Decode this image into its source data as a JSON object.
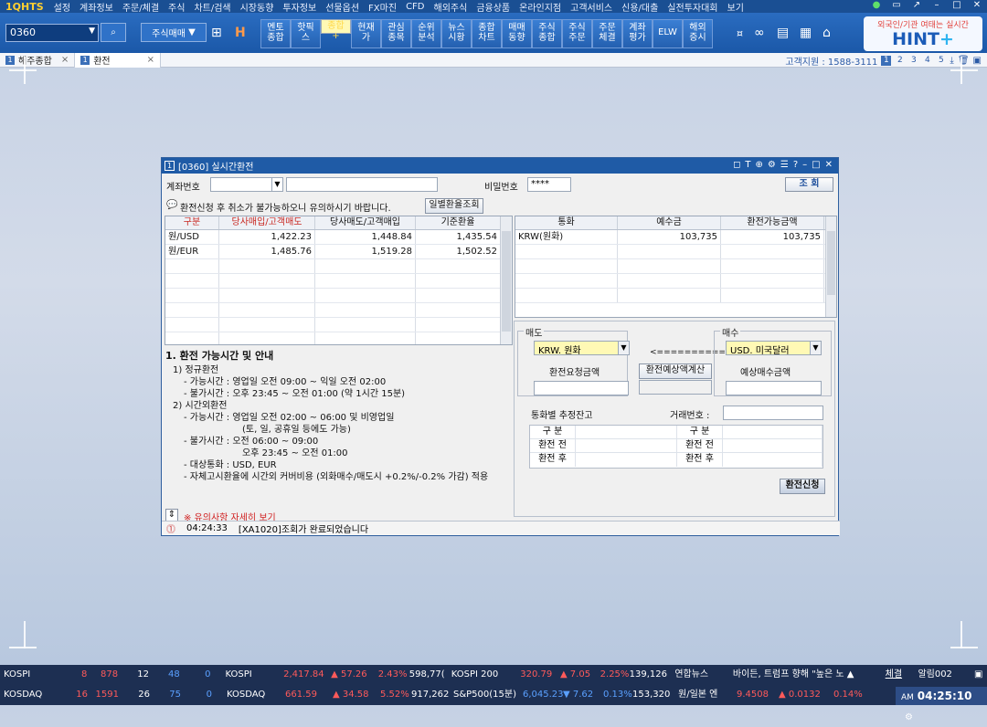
{
  "app": {
    "logo": "1QHTS"
  },
  "menu": [
    "설정",
    "계좌정보",
    "주문/체결",
    "주식",
    "차트/검색",
    "시장동향",
    "투자정보",
    "선물옵션",
    "FX마진",
    "CFD",
    "해외주식",
    "금융상품",
    "온라인지점",
    "고객서비스",
    "신용/대출",
    "실전투자대회",
    "보기"
  ],
  "toolbar": {
    "code_value": "0360",
    "stock_order": "주식매매",
    "quick_buttons": [
      {
        "label": "멘토\n종합"
      },
      {
        "label": "핫픽\n스"
      },
      {
        "label": "종합\n+"
      },
      {
        "label": "현재\n가"
      },
      {
        "label": "관심\n종목"
      },
      {
        "label": "순위\n분석"
      },
      {
        "label": "뉴스\n시황"
      },
      {
        "label": "종합\n차트"
      },
      {
        "label": "매매\n동향"
      },
      {
        "label": "주식\n종합"
      },
      {
        "label": "주식\n주문"
      },
      {
        "label": "주문\n체결"
      },
      {
        "label": "계좌\n평가"
      },
      {
        "label": "ELW"
      },
      {
        "label": "해외\n증시"
      }
    ],
    "hint_small": "외국인/기관 여태는 실시간",
    "hint_big": "HINT",
    "hint_plus": "+"
  },
  "tabs": [
    {
      "label": "해주종합"
    },
    {
      "label": "환전"
    }
  ],
  "tabbar_right": {
    "support": "고객지원 : 1588-3111",
    "pages": [
      "1",
      "2",
      "3",
      "4",
      "5"
    ]
  },
  "window": {
    "title": "[0360] 실시간환전",
    "account_label": "계좌번호",
    "password_label": "비밀번호",
    "password_value": "****",
    "query_button": "조 회",
    "notice": "환전신청 후 취소가 불가능하오니 유의하시기 바랍니다.",
    "daily_rate_button": "일별환율조회",
    "rate_table": {
      "headers": [
        "구분",
        "당사매입/고객매도",
        "당사매도/고객매입",
        "기준환율"
      ],
      "rows": [
        [
          "원/USD",
          "1,422.23",
          "1,448.84",
          "1,435.54"
        ],
        [
          "원/EUR",
          "1,485.76",
          "1,519.28",
          "1,502.52"
        ]
      ]
    },
    "balance_table": {
      "headers": [
        "통화",
        "예수금",
        "환전가능금액"
      ],
      "rows": [
        [
          "KRW(원화)",
          "103,735",
          "103,735"
        ]
      ]
    },
    "guide": {
      "heading": "1. 환전 가능시간 및 안내",
      "lines": [
        "1) 정규환전",
        "- 가능시간 : 영업일 오전 09:00 ~ 익일 오전 02:00",
        "- 불가시간 : 오후 23:45 ~ 오전 01:00 (약 1시간 15분)",
        "2) 시간외환전",
        "- 가능시간 : 영업일 오전 02:00 ~ 06:00 및 비영업일",
        "(토, 일, 공휴일 등에도 가능)",
        "- 불가시간 : 오전 06:00 ~ 09:00",
        "오후 23:45 ~ 오전 01:00",
        "- 대상통화 : USD, EUR",
        "- 자체고시환율에 시간외 커버비용 (외화매수/매도시 +0.2%/-0.2% 가감) 적용"
      ],
      "detail_link": "※ 유의사항 자세히 보기"
    },
    "sell": {
      "title": "매도",
      "currency": "KRW. 원화",
      "amount_label": "환전요청금액"
    },
    "buy": {
      "title": "매수",
      "currency": "USD. 미국달러",
      "amount_label": "예상매수금액"
    },
    "arrow": "<==========>",
    "calc_button": "환전예상액계산",
    "balance_est_label": "통화별 추정잔고",
    "trade_no_label": "거래번호 :",
    "est_table": {
      "h": "구 분",
      "before": "환전 전",
      "after": "환전 후"
    },
    "apply_button": "환전신청",
    "status_time": "04:24:33",
    "status_msg": "[XA1020]조회가 완료되었습니다"
  },
  "bottom": {
    "kospi": {
      "label": "KOSPI",
      "a": "8",
      "b": "878",
      "c": "12",
      "d": "48",
      "e": "0",
      "idx": "KOSPI",
      "val": "2,417.84",
      "chg": "▲ 57.26",
      "pct": "2.43%",
      "vol": "598,77(",
      "k200": "KOSPI 200",
      "k200v": "320.79",
      "k200c": "▲ 7.05",
      "k200p": "2.25%",
      "k200vol": "139,126",
      "news": "연합뉴스",
      "headline": "바이든, 트럼프 향해 \"높은 노 ▲",
      "tab1": "체결",
      "tab2": "알림002"
    },
    "kosdaq": {
      "label": "KOSDAQ",
      "a": "16",
      "b": "1591",
      "c": "26",
      "d": "75",
      "e": "0",
      "idx": "KOSDAQ",
      "val": "661.59",
      "chg": "▲ 34.58",
      "pct": "5.52%",
      "vol": "917,262",
      "sp": "S&P500(15분)",
      "spv": "6,045.23",
      "spc": "▼ 7.62",
      "spp": "0.13%",
      "spvol": "153,320",
      "fx": "원/일본 엔",
      "fxv": "9.4508",
      "fxc": "▲ 0.0132",
      "fxp": "0.14%"
    },
    "clock_ampm": "AM",
    "clock": "04:25:10"
  }
}
